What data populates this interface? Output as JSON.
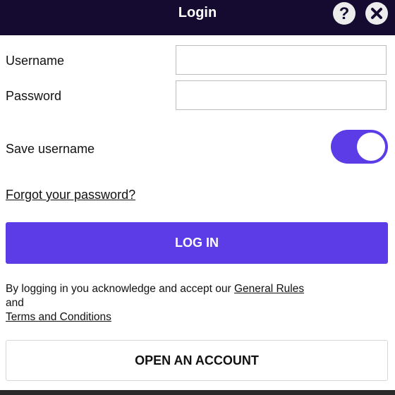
{
  "header": {
    "title": "Login",
    "help_icon": "question-mark-icon",
    "close_icon": "close-icon",
    "background": "#150b31"
  },
  "form": {
    "username_label": "Username",
    "username_value": "",
    "password_label": "Password",
    "password_value": "",
    "save_username_label": "Save username",
    "save_username_on": true,
    "forgot_password": "Forgot your password?",
    "login_button": "LOG IN"
  },
  "legal": {
    "prefix": "By logging in you acknowledge and accept our ",
    "rules_link": "General Rules",
    "middle": " and ",
    "terms_link": "Terms and Conditions"
  },
  "open_account_button": "OPEN AN ACCOUNT",
  "colors": {
    "accent": "#5b3ce6",
    "header": "#150b31"
  }
}
